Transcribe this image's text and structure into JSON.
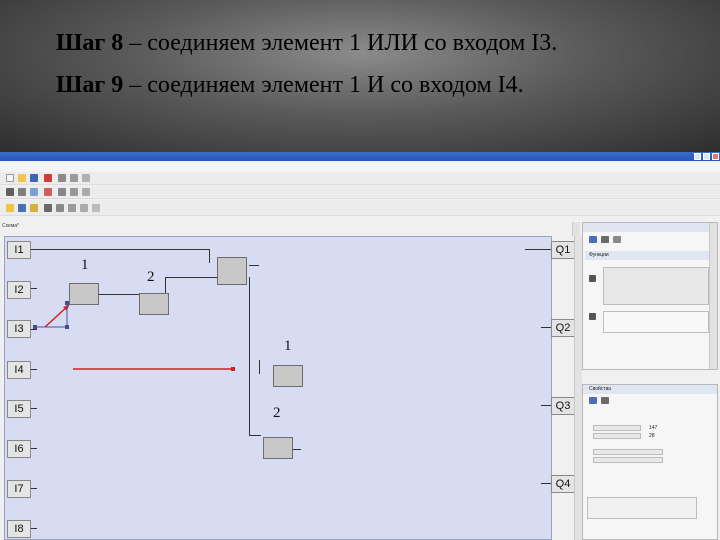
{
  "slide": {
    "step8_label": "Шаг 8",
    "step8_text": " – соединяем элемент 1 ИЛИ со входом I3.",
    "step9_label": "Шаг 9",
    "step9_text": " – соединяем элемент 1 И со входом I4."
  },
  "panel": {
    "title": "Схема*"
  },
  "inputs": [
    "I1",
    "I2",
    "I3",
    "I4",
    "I5",
    "I6",
    "I7",
    "I8"
  ],
  "outputs": [
    "Q1",
    "Q2",
    "Q3",
    "Q4"
  ],
  "annotations": {
    "or_first": "1",
    "or_second": "2",
    "and_first": "1",
    "and_second": "2"
  },
  "right": {
    "functions_title": "Функции",
    "properties_title": "Свойства",
    "val1": "147",
    "val2": "28"
  },
  "colors": {
    "wire_highlight": "#d21e1e",
    "canvas_bg": "#d8dcf2"
  }
}
